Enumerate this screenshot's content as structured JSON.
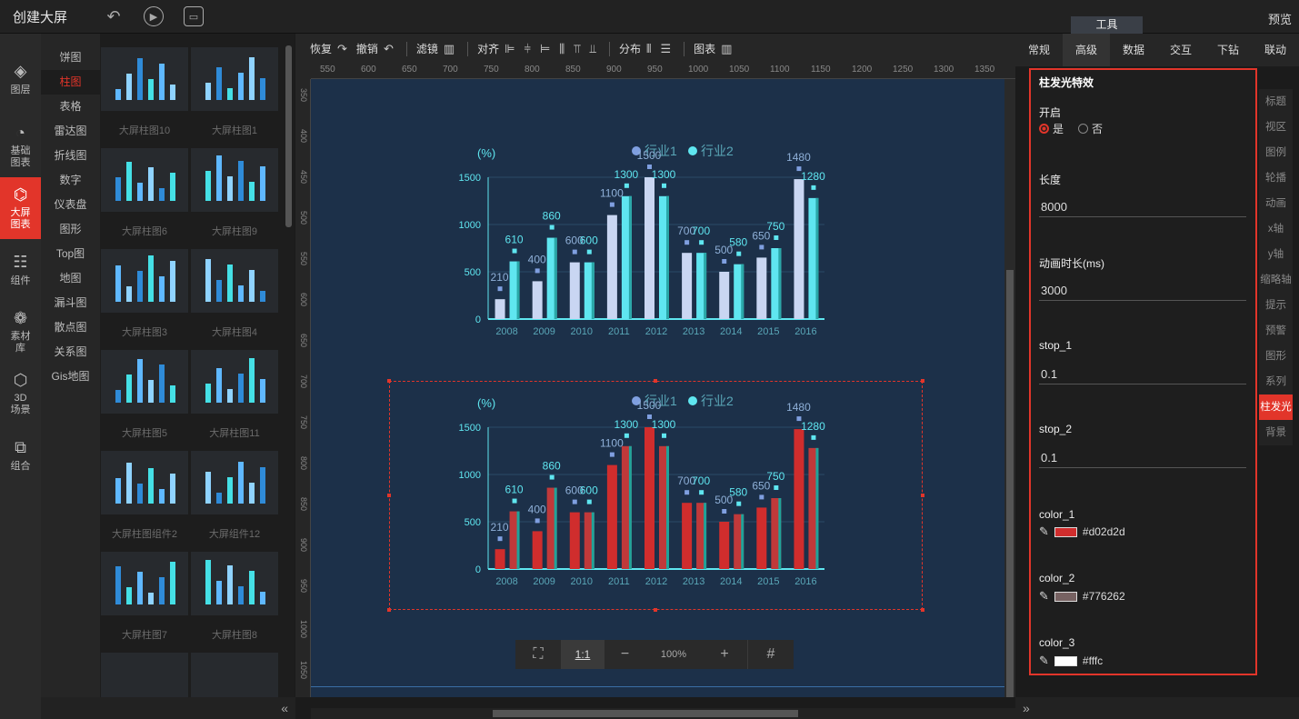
{
  "app": {
    "title": "创建大屏",
    "preview": "预览",
    "tool_tab": "工具"
  },
  "leftnav": [
    {
      "label": "图层",
      "icon": "layers-icon"
    },
    {
      "label": "基础\n图表",
      "icon": "pie-chart-icon"
    },
    {
      "label": "大屏\n图表",
      "icon": "monitor-chart-icon",
      "active": true
    },
    {
      "label": "组件",
      "icon": "sliders-icon"
    },
    {
      "label": "素材\n库",
      "icon": "assets-icon"
    },
    {
      "label": "3D\n场景",
      "icon": "cube-icon"
    },
    {
      "label": "组合",
      "icon": "group-icon"
    }
  ],
  "categories": [
    "饼图",
    "柱图",
    "表格",
    "雷达图",
    "折线图",
    "数字",
    "仪表盘",
    "图形",
    "Top图",
    "地图",
    "漏斗图",
    "散点图",
    "关系图",
    "Gis地图"
  ],
  "active_category": "柱图",
  "thumbnails": [
    "大屏柱图10",
    "大屏柱图1",
    "大屏柱图6",
    "大屏柱图9",
    "大屏柱图3",
    "大屏柱图4",
    "大屏柱图5",
    "大屏柱图11",
    "大屏柱图组件2",
    "大屏组件12",
    "大屏柱图7",
    "大屏柱图8"
  ],
  "toolbar": {
    "redo": "恢复",
    "undo": "撤销",
    "filter": "滤镜",
    "align": "对齐",
    "distribute": "分布",
    "chart": "图表"
  },
  "ruler_h": [
    "550",
    "600",
    "650",
    "700",
    "750",
    "800",
    "850",
    "900",
    "950",
    "1000",
    "1050",
    "1100",
    "1150",
    "1200",
    "1250",
    "1300",
    "1350"
  ],
  "ruler_v": [
    "350",
    "400",
    "450",
    "500",
    "550",
    "600",
    "650",
    "700",
    "750",
    "800",
    "850",
    "900",
    "950",
    "1000",
    "1050"
  ],
  "zoom": {
    "fit": "1:1",
    "minus": "−",
    "value": "100%",
    "plus": "+"
  },
  "right_tabs": [
    "常规",
    "高级",
    "数据",
    "交互",
    "下钻",
    "联动"
  ],
  "active_right_tab": "高级",
  "panel": {
    "section": "柱发光特效",
    "enable_label": "开启",
    "yes": "是",
    "no": "否",
    "length_label": "长度",
    "length": "8000",
    "duration_label": "动画时长(ms)",
    "duration": "3000",
    "stop1_label": "stop_1",
    "stop1": "0.1",
    "stop2_label": "stop_2",
    "stop2": "0.1",
    "color1_label": "color_1",
    "color1": "#d02d2d",
    "color2_label": "color_2",
    "color2": "#776262",
    "color3_label": "color_3",
    "color3": "#fffc"
  },
  "side_tabs": [
    "标题",
    "视区",
    "图例",
    "轮播",
    "动画",
    "x轴",
    "y轴",
    "缩略轴",
    "提示",
    "预警",
    "图形",
    "系列",
    "柱发光",
    "背景"
  ],
  "active_side_tab": "柱发光",
  "chart_data": [
    {
      "type": "bar",
      "ylabel": "(%)",
      "legend": [
        "行业1",
        "行业2"
      ],
      "categories": [
        "2008",
        "2009",
        "2010",
        "2011",
        "2012",
        "2013",
        "2014",
        "2015",
        "2016"
      ],
      "series": [
        {
          "name": "行业1",
          "values": [
            210,
            400,
            600,
            1100,
            1500,
            700,
            500,
            650,
            1480
          ]
        },
        {
          "name": "行业2",
          "values": [
            610,
            860,
            600,
            1300,
            1300,
            700,
            580,
            750,
            1280
          ]
        }
      ],
      "ylim": [
        0,
        1500
      ],
      "yticks": [
        0,
        500,
        1000,
        1500
      ],
      "colors": [
        "#c9d6f2",
        "#5fe6f0"
      ]
    },
    {
      "type": "bar",
      "ylabel": "(%)",
      "legend": [
        "行业1",
        "行业2"
      ],
      "categories": [
        "2008",
        "2009",
        "2010",
        "2011",
        "2012",
        "2013",
        "2014",
        "2015",
        "2016"
      ],
      "series": [
        {
          "name": "行业1",
          "values": [
            210,
            400,
            600,
            1100,
            1500,
            700,
            500,
            650,
            1480
          ]
        },
        {
          "name": "行业2",
          "values": [
            610,
            860,
            600,
            1300,
            1300,
            700,
            580,
            750,
            1280
          ]
        }
      ],
      "ylim": [
        0,
        1500
      ],
      "yticks": [
        0,
        500,
        1000,
        1500
      ],
      "colors": [
        "#d02d2d",
        "#d02d2d"
      ]
    }
  ]
}
